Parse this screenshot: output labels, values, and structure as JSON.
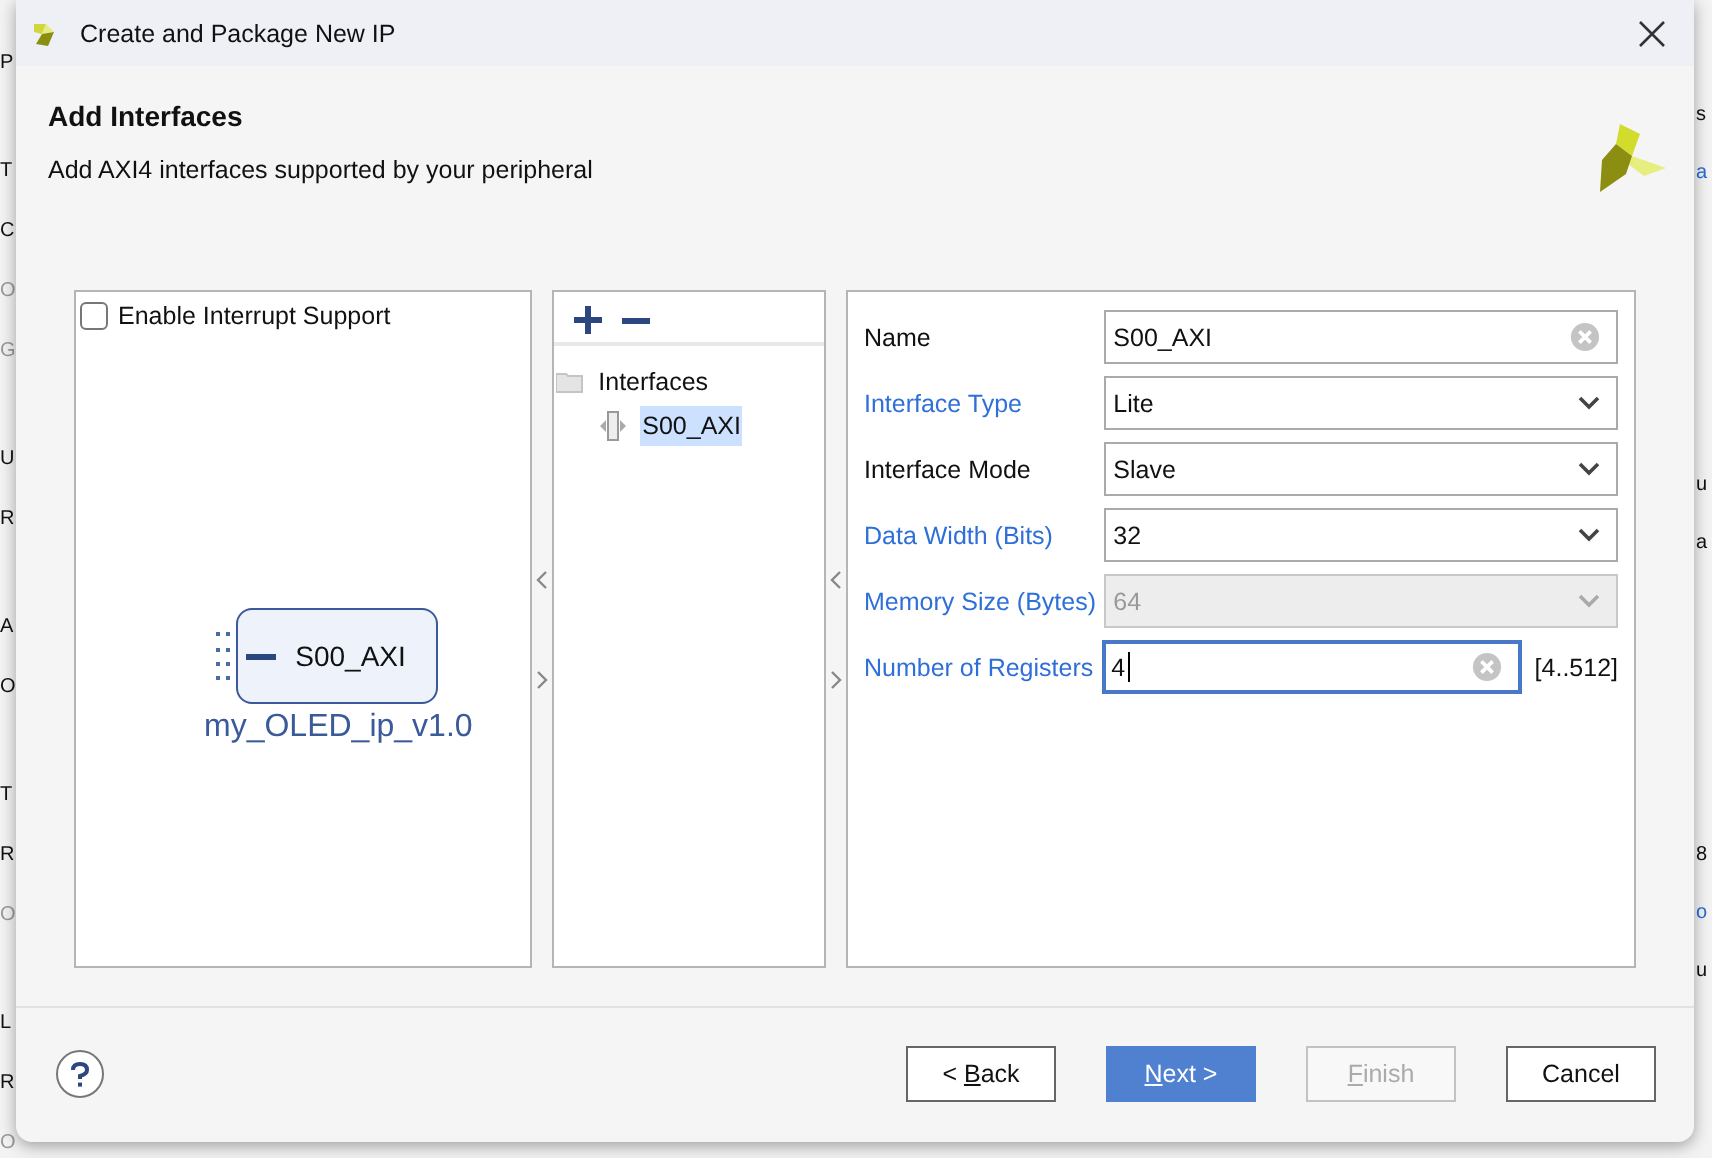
{
  "background_app": {
    "left_groups": [
      [
        {
          "text": "P",
          "muted": false
        }
      ],
      [
        {
          "text": "T",
          "muted": false
        },
        {
          "text": "C",
          "muted": false
        },
        {
          "text": "O",
          "muted": true
        },
        {
          "text": "G",
          "muted": true
        }
      ],
      [
        {
          "text": "U",
          "muted": false
        },
        {
          "text": "R",
          "muted": false
        }
      ],
      [
        {
          "text": "A",
          "muted": false
        },
        {
          "text": "O",
          "muted": false
        }
      ],
      [
        {
          "text": "T",
          "muted": false
        },
        {
          "text": "R",
          "muted": false
        },
        {
          "text": "O",
          "muted": true
        }
      ],
      [
        {
          "text": "L",
          "muted": false
        },
        {
          "text": "R",
          "muted": false
        },
        {
          "text": "O",
          "muted": true
        }
      ]
    ],
    "right_groups": [
      [
        {
          "text": "s",
          "kind": "plain"
        },
        {
          "text": "a",
          "kind": "link"
        }
      ],
      [
        {
          "text": "u",
          "kind": "plain"
        },
        {
          "text": "a",
          "kind": "plain"
        }
      ],
      [
        {
          "text": "8",
          "kind": "plain"
        },
        {
          "text": "o",
          "kind": "link"
        },
        {
          "text": "u",
          "kind": "plain"
        }
      ]
    ]
  },
  "window": {
    "title": "Create and Package New IP"
  },
  "header": {
    "title": "Add Interfaces",
    "subtitle": "Add AXI4 interfaces supported by your peripheral"
  },
  "interrupt_checkbox": {
    "label": "Enable Interrupt Support",
    "checked": false
  },
  "block_diagram": {
    "port": "S00_AXI",
    "ip_name": "my_OLED_ip_v1.0"
  },
  "interfaces_tree": {
    "label": "Interfaces",
    "children": [
      {
        "label": "S00_AXI",
        "selected": true
      }
    ]
  },
  "properties": [
    {
      "label": "Name",
      "linked": false,
      "kind": "text",
      "value": "S00_AXI",
      "disabled": false,
      "focused": false
    },
    {
      "label": "Interface Type",
      "linked": true,
      "kind": "select",
      "value": "Lite",
      "disabled": false,
      "focused": false
    },
    {
      "label": "Interface Mode",
      "linked": false,
      "kind": "select",
      "value": "Slave",
      "disabled": false,
      "focused": false
    },
    {
      "label": "Data Width (Bits)",
      "linked": true,
      "kind": "select",
      "value": "32",
      "disabled": false,
      "focused": false
    },
    {
      "label": "Memory Size (Bytes)",
      "linked": true,
      "kind": "select",
      "value": "64",
      "disabled": true,
      "focused": false
    },
    {
      "label": "Number of Registers",
      "linked": true,
      "kind": "text",
      "value": "4",
      "disabled": false,
      "focused": true,
      "range": "[4..512]"
    }
  ],
  "buttons": [
    {
      "before": "< ",
      "key": "B",
      "after": "ack",
      "kind": "default",
      "disabled": false
    },
    {
      "key": "N",
      "after": "ext >",
      "kind": "primary",
      "disabled": false
    },
    {
      "key": "F",
      "after": "inish",
      "kind": "default",
      "disabled": true
    },
    {
      "after": "Cancel",
      "kind": "default",
      "disabled": false
    }
  ]
}
